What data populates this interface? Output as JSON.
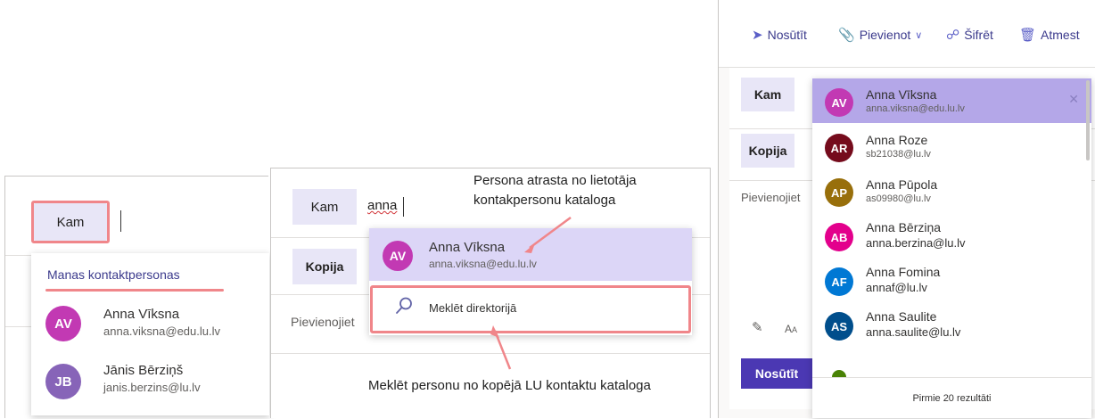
{
  "panel1": {
    "to_label": "Kam",
    "dropdown_header": "Manas kontaktpersonas",
    "contacts": [
      {
        "initials": "AV",
        "name": "Anna Vīksna",
        "email": "anna.viksna@edu.lu.lv",
        "color": "#c239b3"
      },
      {
        "initials": "JB",
        "name": "Jānis Bērziņš",
        "email": "janis.berzins@lu.lv",
        "color": "#8764b8"
      }
    ]
  },
  "panel2": {
    "to_label": "Kam",
    "to_value": "anna",
    "cc_label": "Kopija",
    "attach_text": "Pievienojiet",
    "suggestion": {
      "initials": "AV",
      "name": "Anna Vīksna",
      "email": "anna.viksna@edu.lu.lv",
      "color": "#c239b3"
    },
    "search_directory": "Meklēt direktorijā",
    "annotation_top": [
      "Persona atrasta no lietotāja",
      "kontakpersonu kataloga"
    ],
    "annotation_bottom": "Meklēt personu no kopējā LU kontaktu kataloga"
  },
  "panel3": {
    "toolbar": {
      "send": "Nosūtīt",
      "attach": "Pievienot",
      "encrypt": "Šifrēt",
      "discard": "Atmest"
    },
    "to_label": "Kam",
    "cc_label": "Kopija",
    "attach_text": "Pievienojiet",
    "send_button": "Nosūtīt",
    "results_footer": "Pirmie 20 rezultāti",
    "results": [
      {
        "initials": "AV",
        "name": "Anna Vīksna",
        "email": "anna.viksna@edu.lu.lv",
        "color": "#c239b3"
      },
      {
        "initials": "AR",
        "name": "Anna Roze",
        "email": "sb21038@lu.lv",
        "color": "#750b1c"
      },
      {
        "initials": "AP",
        "name": "Anna Pūpola",
        "email": "as09980@lu.lv",
        "color": "#986f0b"
      },
      {
        "initials": "AB",
        "name": "Anna Bērziņa",
        "email": "anna.berzina@lu.lv",
        "color": "#e3008c"
      },
      {
        "initials": "AF",
        "name": "Anna Fomina",
        "email": "annaf@lu.lv",
        "color": "#0078d4"
      },
      {
        "initials": "AS",
        "name": "Anna Saulite",
        "email": "anna.saulite@lu.lv",
        "color": "#004e8c"
      }
    ]
  }
}
